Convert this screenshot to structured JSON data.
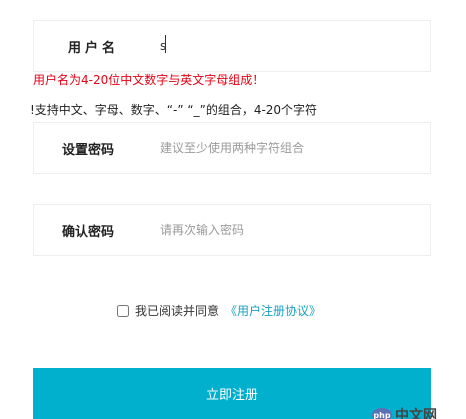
{
  "form": {
    "username": {
      "label": "用户名",
      "value": "s"
    },
    "username_error": "用户名为4-20位中文数字与英文字母组成！",
    "username_hint": "!支持中文、字母、数字、“-” “_”的组合，4-20个字符",
    "password": {
      "label": "设置密码",
      "placeholder": "建议至少使用两种字符组合"
    },
    "confirm": {
      "label": "确认密码",
      "placeholder": "请再次输入密码"
    },
    "agreement": {
      "text": "我已阅读并同意",
      "link": "《用户注册协议》",
      "checked": false
    },
    "submit_label": "立即注册"
  },
  "watermark": {
    "logo_text": "php",
    "site_text": "中文网"
  }
}
